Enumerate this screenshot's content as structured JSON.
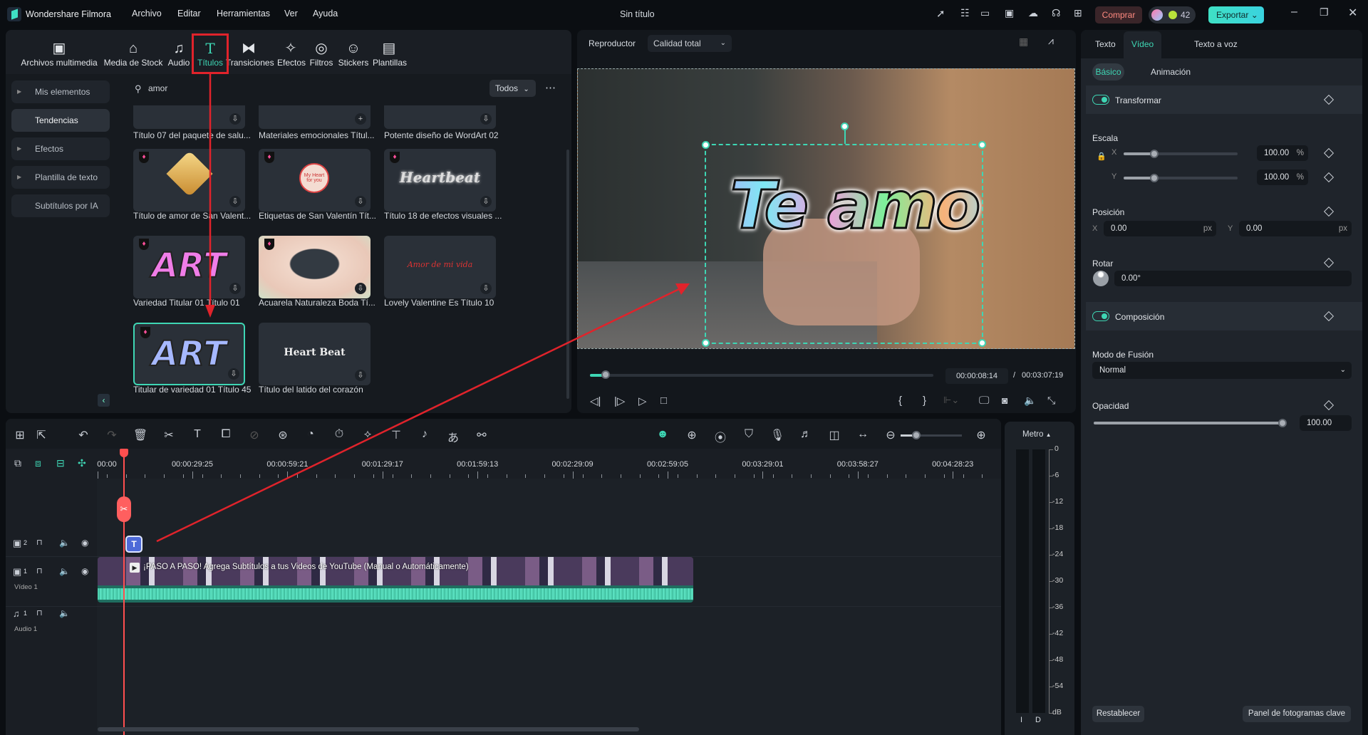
{
  "app": {
    "name": "Wondershare Filmora",
    "title": "Sin título"
  },
  "menu": [
    "Archivo",
    "Editar",
    "Herramientas",
    "Ver",
    "Ayuda"
  ],
  "topbar": {
    "buy_label": "Comprar",
    "credits": "42",
    "export_label": "Exportar"
  },
  "media_tabs": [
    {
      "label": "Archivos multimedia",
      "icon": "media-icon"
    },
    {
      "label": "Media de Stock",
      "icon": "stock-icon"
    },
    {
      "label": "Audio",
      "icon": "music-note-icon"
    },
    {
      "label": "Títulos",
      "icon": "text-t-icon",
      "active": true
    },
    {
      "label": "Transiciones",
      "icon": "transition-icon"
    },
    {
      "label": "Efectos",
      "icon": "effects-icon"
    },
    {
      "label": "Filtros",
      "icon": "filter-icon"
    },
    {
      "label": "Stickers",
      "icon": "sticker-icon"
    },
    {
      "label": "Plantillas",
      "icon": "template-icon"
    }
  ],
  "sidebar": [
    {
      "label": "Mis elementos",
      "expandable": true
    },
    {
      "label": "Tendencias",
      "active": true
    },
    {
      "label": "Efectos",
      "expandable": true
    },
    {
      "label": "Plantilla de texto",
      "expandable": true
    },
    {
      "label": "Subtítulos por IA"
    }
  ],
  "search": {
    "value": "amor",
    "filter": "Todos"
  },
  "titles": [
    {
      "label": "Título 07 del paquete de salu...",
      "thumb": "",
      "premium": false
    },
    {
      "label": "Materiales emocionales Títul...",
      "thumb": "",
      "premium": false
    },
    {
      "label": "Potente diseño de WordArt 02",
      "thumb": "",
      "premium": false
    },
    {
      "label": "Título de amor de San Valent...",
      "thumb": "",
      "premium": true
    },
    {
      "label": "Etiquetas de San Valentín Tít...",
      "thumb": "My Heart for you",
      "premium": true
    },
    {
      "label": "Título 18 de efectos visuales ...",
      "thumb": "Heartbeat",
      "premium": true
    },
    {
      "label": "Variedad Titular 01 Título 01",
      "thumb": "ART",
      "premium": true
    },
    {
      "label": "Acuarela Naturaleza Boda Tí...",
      "thumb": "",
      "premium": true
    },
    {
      "label": "Lovely Valentine Es Título 10",
      "thumb": "Amor de mi vida",
      "premium": false
    },
    {
      "label": "Titular de variedad 01 Título 45",
      "thumb": "ART",
      "premium": true,
      "selected": true
    },
    {
      "label": "Título del latido del corazón",
      "thumb": "Heart Beat",
      "premium": false
    }
  ],
  "player": {
    "label": "Reproductor",
    "quality": "Calidad total",
    "overlay_text": "Te amo",
    "current_time": "00:00:08:14",
    "total_time": "00:03:07:19",
    "progress": 0.045
  },
  "inspector": {
    "tabs": [
      "Texto",
      "Vídeo",
      "Texto a voz"
    ],
    "active_tab": "Vídeo",
    "subtabs": [
      "Básico",
      "Animación"
    ],
    "transform": {
      "title": "Transformar",
      "enabled": true,
      "scale_label": "Escala",
      "scale_x": "100.00",
      "scale_y": "100.00",
      "unit": "%",
      "scale_x_fraction": 0.27,
      "scale_y_fraction": 0.27,
      "position_label": "Posición",
      "pos_x": "0.00",
      "pos_y": "0.00",
      "pos_unit": "px",
      "rotate_label": "Rotar",
      "rotate": "0.00°"
    },
    "composition": {
      "title": "Composición",
      "enabled": true,
      "blend_label": "Modo de Fusión",
      "blend": "Normal",
      "opacity_label": "Opacidad",
      "opacity": "100.00",
      "opacity_fraction": 1.0
    },
    "reset_label": "Restablecer",
    "keyframe_label": "Panel de fotogramas clave"
  },
  "timeline": {
    "ruler": [
      "00:00",
      "00:00:29:25",
      "00:00:59:21",
      "00:01:29:17",
      "00:01:59:13",
      "00:02:29:09",
      "00:02:59:05",
      "00:03:29:01",
      "00:03:58:27",
      "00:04:28:23"
    ],
    "tracks": [
      {
        "number": "2",
        "label": ""
      },
      {
        "number": "1",
        "label": "Vídeo 1"
      },
      {
        "number": "1",
        "label": "Audio 1"
      }
    ],
    "clip_title": "¡PASO A PASO! Agrega Subtítulos a tus Videos de YouTube (Manual o Automáticamente)",
    "zoom_fraction": 0.25
  },
  "meter": {
    "label": "Metro",
    "scale": [
      "0",
      "-6",
      "-12",
      "-18",
      "-24",
      "-30",
      "-36",
      "-42",
      "-48",
      "-54",
      "dB"
    ],
    "channels": [
      "I",
      "D"
    ]
  },
  "colors": {
    "accent": "#3ed6b4",
    "annotation": "#e0232b",
    "buy": "#ff7a7a",
    "export": "#3fe0c5"
  }
}
